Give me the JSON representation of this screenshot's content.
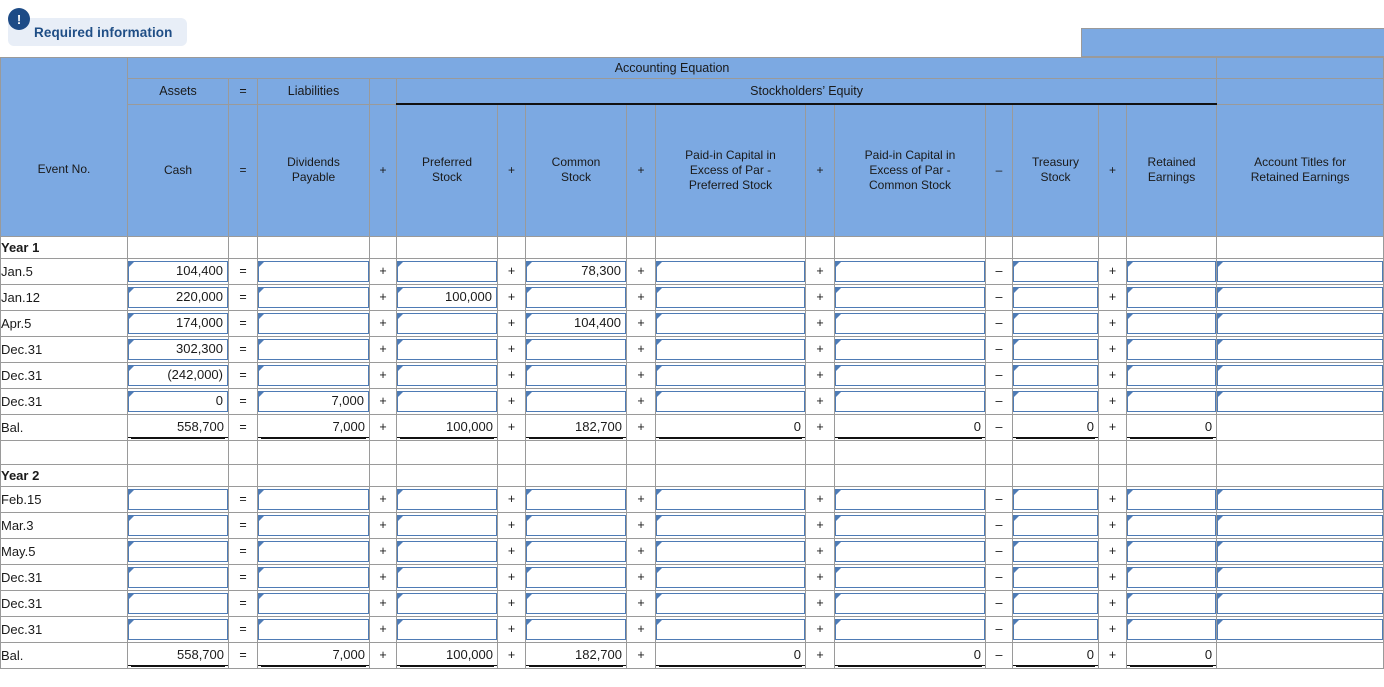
{
  "banner": {
    "icon": "exclamation-icon",
    "icon_glyph": "!",
    "label": "Required information"
  },
  "colors": {
    "header_blue": "#7CA9E2",
    "banner_bg": "#e8eef7",
    "banner_text": "#1f4e86",
    "badge_bg": "#1d4b86",
    "input_border": "#4E7BB5",
    "grid_line": "#9a9a9a"
  },
  "table": {
    "title": "Accounting Equation",
    "groups": {
      "assets": "Assets",
      "eq_sign": "=",
      "liabilities": "Liabilities",
      "stockholders_equity": "Stockholders’ Equity"
    },
    "columns": [
      {
        "key": "event",
        "label": "Event No."
      },
      {
        "key": "cash",
        "label": "Cash"
      },
      {
        "key": "op1",
        "label": "="
      },
      {
        "key": "div_payable",
        "label": "Dividends Payable"
      },
      {
        "key": "op2",
        "label": "+"
      },
      {
        "key": "preferred_stock",
        "label": "Preferred Stock"
      },
      {
        "key": "op3",
        "label": "+"
      },
      {
        "key": "common_stock",
        "label": "Common Stock"
      },
      {
        "key": "op4",
        "label": "+"
      },
      {
        "key": "pic_excess_preferred",
        "label": "Paid-in Capital in Excess of Par - Preferred Stock"
      },
      {
        "key": "op5",
        "label": "+"
      },
      {
        "key": "pic_excess_common",
        "label": "Paid-in Capital in Excess of Par - Common Stock"
      },
      {
        "key": "op6",
        "label": "–"
      },
      {
        "key": "treasury_stock",
        "label": "Treasury Stock"
      },
      {
        "key": "op7",
        "label": "+"
      },
      {
        "key": "retained_earnings",
        "label": "Retained Earnings"
      },
      {
        "key": "account_titles",
        "label": "Account Titles for Retained Earnings"
      }
    ],
    "column_header_lines": {
      "pic_excess_preferred": [
        "Paid-in Capital in",
        "Excess of Par -",
        "Preferred Stock"
      ],
      "pic_excess_common": [
        "Paid-in Capital in",
        "Excess of Par -",
        "Common Stock"
      ],
      "div_payable": [
        "Dividends",
        "Payable"
      ],
      "preferred_stock": [
        "Preferred",
        "Stock"
      ],
      "common_stock": [
        "Common",
        "Stock"
      ],
      "treasury_stock": [
        "Treasury",
        "Stock"
      ],
      "retained_earnings": [
        "Retained",
        "Earnings"
      ],
      "account_titles": [
        "Account Titles for",
        "Retained Earnings"
      ]
    },
    "sections": [
      {
        "title": "Year 1",
        "rows": [
          {
            "event": "Jan.5",
            "cash": "104,400",
            "div_payable": "",
            "preferred_stock": "",
            "common_stock": "78,300",
            "pic_excess_preferred": "",
            "pic_excess_common": "",
            "treasury_stock": "",
            "retained_earnings": "",
            "account_titles": ""
          },
          {
            "event": "Jan.12",
            "cash": "220,000",
            "div_payable": "",
            "preferred_stock": "100,000",
            "common_stock": "",
            "pic_excess_preferred": "",
            "pic_excess_common": "",
            "treasury_stock": "",
            "retained_earnings": "",
            "account_titles": ""
          },
          {
            "event": "Apr.5",
            "cash": "174,000",
            "div_payable": "",
            "preferred_stock": "",
            "common_stock": "104,400",
            "pic_excess_preferred": "",
            "pic_excess_common": "",
            "treasury_stock": "",
            "retained_earnings": "",
            "account_titles": ""
          },
          {
            "event": "Dec.31",
            "cash": "302,300",
            "div_payable": "",
            "preferred_stock": "",
            "common_stock": "",
            "pic_excess_preferred": "",
            "pic_excess_common": "",
            "treasury_stock": "",
            "retained_earnings": "",
            "account_titles": ""
          },
          {
            "event": "Dec.31",
            "cash": "(242,000)",
            "div_payable": "",
            "preferred_stock": "",
            "common_stock": "",
            "pic_excess_preferred": "",
            "pic_excess_common": "",
            "treasury_stock": "",
            "retained_earnings": "",
            "account_titles": ""
          },
          {
            "event": "Dec.31",
            "cash": "0",
            "div_payable": "7,000",
            "preferred_stock": "",
            "common_stock": "",
            "pic_excess_preferred": "",
            "pic_excess_common": "",
            "treasury_stock": "",
            "retained_earnings": "",
            "account_titles": ""
          }
        ],
        "balance": {
          "event": "Bal.",
          "cash": "558,700",
          "div_payable": "7,000",
          "preferred_stock": "100,000",
          "common_stock": "182,700",
          "pic_excess_preferred": "0",
          "pic_excess_common": "0",
          "treasury_stock": "0",
          "retained_earnings": "0",
          "account_titles": ""
        }
      },
      {
        "title": "Year 2",
        "rows": [
          {
            "event": "Feb.15",
            "cash": "",
            "div_payable": "",
            "preferred_stock": "",
            "common_stock": "",
            "pic_excess_preferred": "",
            "pic_excess_common": "",
            "treasury_stock": "",
            "retained_earnings": "",
            "account_titles": ""
          },
          {
            "event": "Mar.3",
            "cash": "",
            "div_payable": "",
            "preferred_stock": "",
            "common_stock": "",
            "pic_excess_preferred": "",
            "pic_excess_common": "",
            "treasury_stock": "",
            "retained_earnings": "",
            "account_titles": ""
          },
          {
            "event": "May.5",
            "cash": "",
            "div_payable": "",
            "preferred_stock": "",
            "common_stock": "",
            "pic_excess_preferred": "",
            "pic_excess_common": "",
            "treasury_stock": "",
            "retained_earnings": "",
            "account_titles": ""
          },
          {
            "event": "Dec.31",
            "cash": "",
            "div_payable": "",
            "preferred_stock": "",
            "common_stock": "",
            "pic_excess_preferred": "",
            "pic_excess_common": "",
            "treasury_stock": "",
            "retained_earnings": "",
            "account_titles": ""
          },
          {
            "event": "Dec.31",
            "cash": "",
            "div_payable": "",
            "preferred_stock": "",
            "common_stock": "",
            "pic_excess_preferred": "",
            "pic_excess_common": "",
            "treasury_stock": "",
            "retained_earnings": "",
            "account_titles": ""
          },
          {
            "event": "Dec.31",
            "cash": "",
            "div_payable": "",
            "preferred_stock": "",
            "common_stock": "",
            "pic_excess_preferred": "",
            "pic_excess_common": "",
            "treasury_stock": "",
            "retained_earnings": "",
            "account_titles": ""
          }
        ],
        "balance": {
          "event": "Bal.",
          "cash": "558,700",
          "div_payable": "7,000",
          "preferred_stock": "100,000",
          "common_stock": "182,700",
          "pic_excess_preferred": "0",
          "pic_excess_common": "0",
          "treasury_stock": "0",
          "retained_earnings": "0",
          "account_titles": ""
        }
      }
    ]
  }
}
